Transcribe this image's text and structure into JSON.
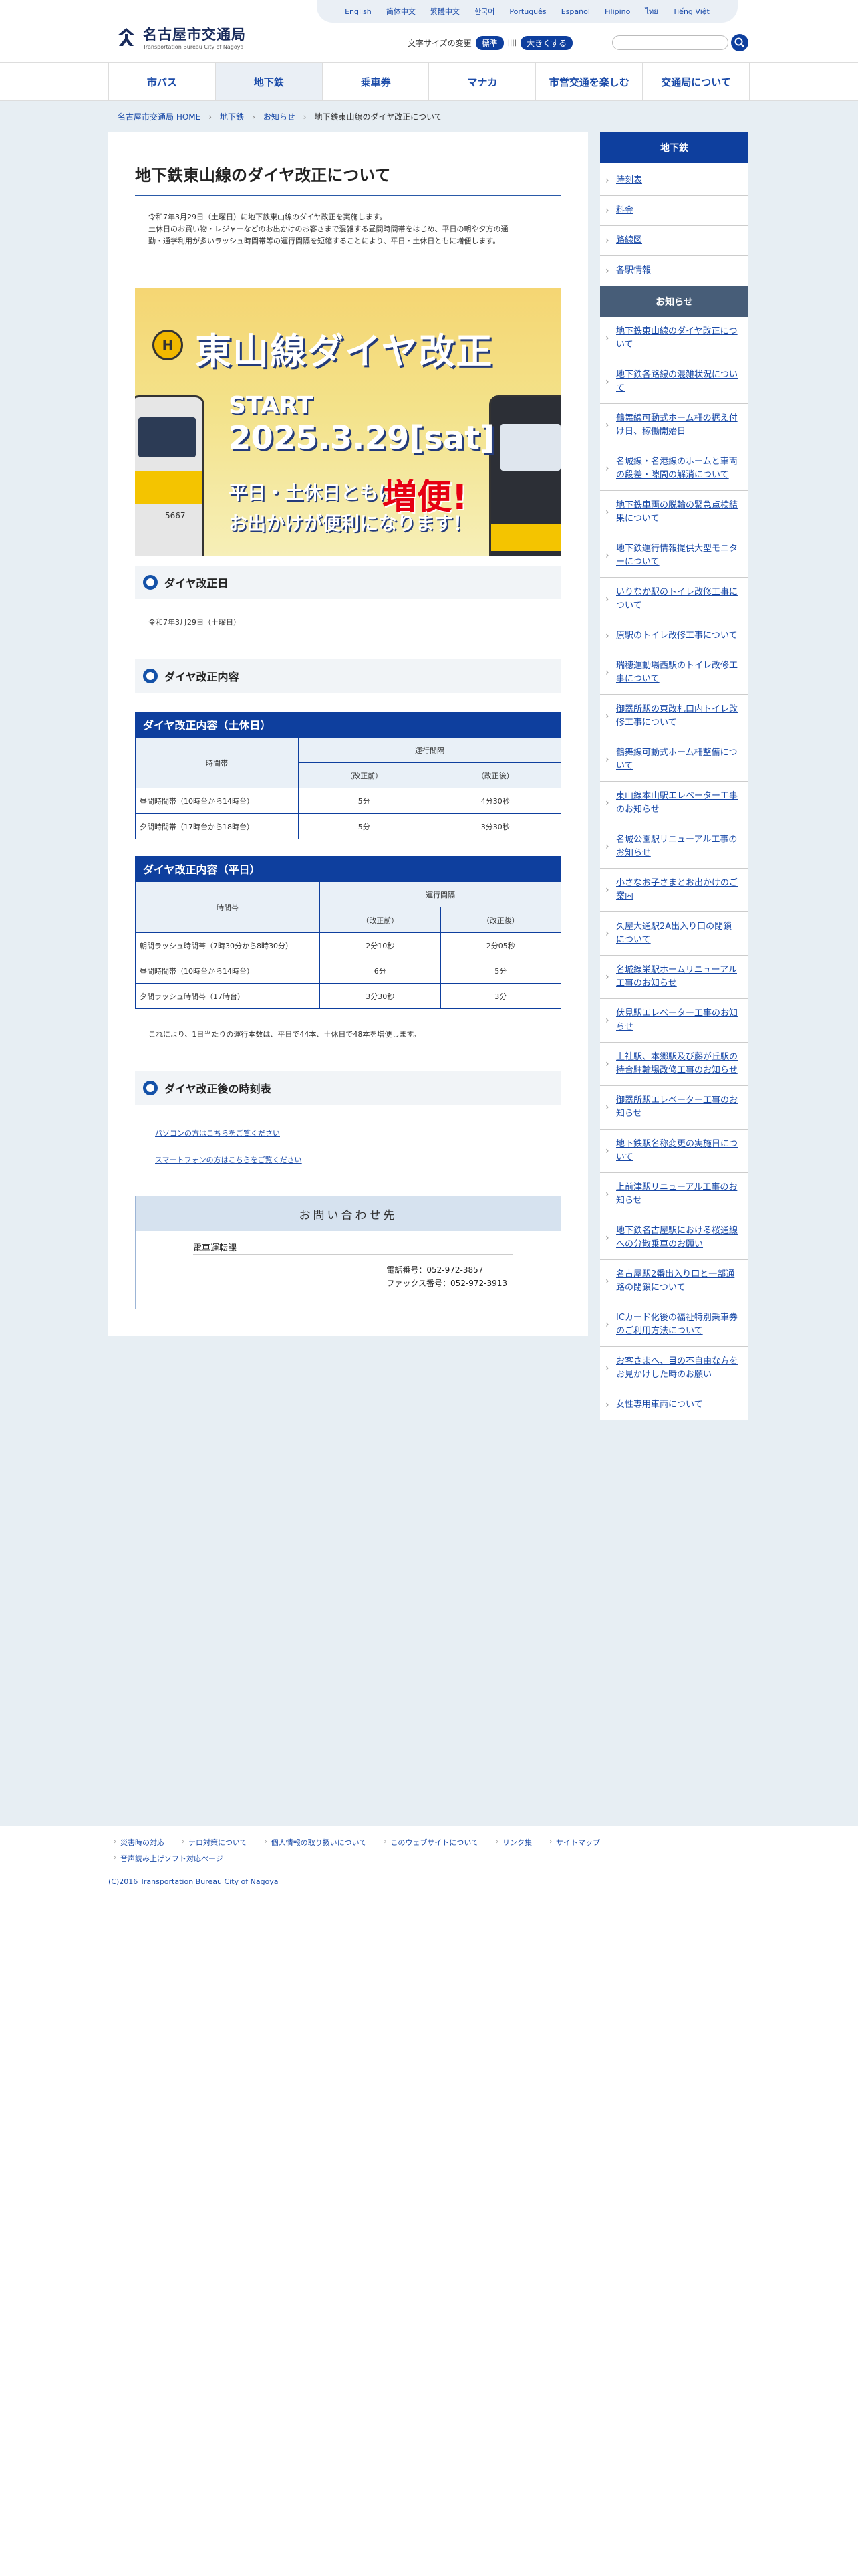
{
  "languages": [
    "English",
    "简体中文",
    "繁體中文",
    "한국어",
    "Português",
    "Español",
    "Filipino",
    "ไทย",
    "Tiếng Việt"
  ],
  "logo": {
    "jp": "名古屋市交通局",
    "en": "Transportation Bureau City of Nagoya"
  },
  "fontsize": {
    "label": "文字サイズの変更",
    "standard": "標準",
    "bigger": "大きくする"
  },
  "search": {
    "placeholder": ""
  },
  "gnav": [
    "市バス",
    "地下鉄",
    "乗車券",
    "マナカ",
    "市営交通を楽しむ",
    "交通局について"
  ],
  "breadcrumb": {
    "home": "名古屋市交通局 HOME",
    "l1": "地下鉄",
    "l2": "お知らせ",
    "current": "地下鉄東山線のダイヤ改正について"
  },
  "page": {
    "title": "地下鉄東山線のダイヤ改正について",
    "intro1": "令和7年3月29日（土曜日）に地下鉄東山線のダイヤ改正を実施します。",
    "intro2": "土休日のお買い物・レジャーなどのお出かけのお客さまで混雑する昼間時間帯をはじめ、平日の朝や夕方の通",
    "intro3": "勤・通学利用が多いラッシュ時間帯等の運行間隔を短縮することにより、平日・土休日ともに増便します。"
  },
  "banner": {
    "badge": "H",
    "title": "東山線ダイヤ改正",
    "start": "START",
    "date": "2025.3.29[sat]",
    "line1": "平日・土休日ともに",
    "increase": "増便!",
    "line2": "お出かけが便利になります！",
    "train_no": "5667"
  },
  "sections": {
    "date_title": "ダイヤ改正日",
    "date_text": "令和7年3月29日（土曜日）",
    "content_title": "ダイヤ改正内容",
    "holiday_title": "ダイヤ改正内容（土休日）",
    "weekday_title": "ダイヤ改正内容（平日）",
    "note": "これにより、1日当たりの運行本数は、平日で44本、土休日で48本を増便します。",
    "timetable_title": "ダイヤ改正後の時刻表",
    "pc_link": "パソコンの方はこちらをご覧ください",
    "sp_link": "スマートフォンの方はこちらをご覧ください"
  },
  "holiday_table": {
    "h_time": "時間帯",
    "h_interval": "運行間隔",
    "h_before": "（改正前）",
    "h_after": "（改正後）",
    "rows": [
      [
        "昼間時間帯（10時台から14時台）",
        "5分",
        "4分30秒"
      ],
      [
        "夕間時間帯（17時台から18時台）",
        "5分",
        "3分30秒"
      ]
    ]
  },
  "weekday_table": {
    "h_time": "時間帯",
    "h_interval": "運行間隔",
    "h_before": "（改正前）",
    "h_after": "（改正後）",
    "rows": [
      [
        "朝間ラッシュ時間帯（7時30分から8時30分）",
        "2分10秒",
        "2分05秒"
      ],
      [
        "昼間時間帯（10時台から14時台）",
        "6分",
        "5分"
      ],
      [
        "夕間ラッシュ時間帯（17時台）",
        "3分30秒",
        "3分"
      ]
    ]
  },
  "contact": {
    "heading": "お問い合わせ先",
    "dept": "電車運転課",
    "tel": "電話番号：052-972-3857",
    "fax": "ファックス番号：052-972-3913"
  },
  "sidebar": {
    "heading": "地下鉄",
    "items": [
      "時刻表",
      "料金",
      "路線図",
      "各駅情報"
    ],
    "sub": "お知らせ",
    "news": [
      "地下鉄東山線のダイヤ改正について",
      "地下鉄各路線の混雑状況について",
      "鶴舞線可動式ホーム柵の据え付け日、稼働開始日",
      "名城線・名港線のホームと車両の段差・隙間の解消について",
      "地下鉄車両の脱輪の緊急点検結果について",
      "地下鉄運行情報提供大型モニターについて",
      "いりなか駅のトイレ改修工事について",
      "原駅のトイレ改修工事について",
      "瑞穂運動場西駅のトイレ改修工事について",
      "御器所駅の東改札口内トイレ改修工事について",
      "鶴舞線可動式ホーム柵整備について",
      "東山線本山駅エレベーター工事のお知らせ",
      "名城公園駅リニューアル工事のお知らせ",
      "小さなお子さまとお出かけのご案内",
      "久屋大通駅2A出入り口の閉鎖について",
      "名城線栄駅ホームリニューアル工事のお知らせ",
      "伏見駅エレベーター工事のお知らせ",
      "上社駅、本郷駅及び藤が丘駅の持合駐輪場改修工事のお知らせ",
      "御器所駅エレベーター工事のお知らせ",
      "地下鉄駅名称変更の実施日について",
      "上前津駅リニューアル工事のお知らせ",
      "地下鉄名古屋駅における桜通線への分散乗車のお願い",
      "名古屋駅2番出入り口と一部通路の閉鎖について",
      "ICカード化後の福祉特別乗車券のご利用方法について",
      "お客さまへ、目の不自由な方をお見かけした時のお願い",
      "女性専用車両について"
    ]
  },
  "footer": {
    "links": [
      "災害時の対応",
      "テロ対策について",
      "個人情報の取り扱いについて",
      "このウェブサイトについて",
      "リンク集",
      "サイトマップ",
      "音声読み上げソフト対応ページ"
    ],
    "copyright": "(C)2016 Transportation Bureau City of Nagoya"
  }
}
